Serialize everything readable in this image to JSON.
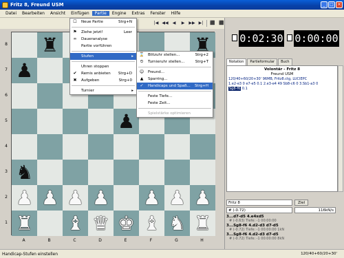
{
  "window": {
    "title": "Fritz 8, Freund USM"
  },
  "menubar": [
    "Datei",
    "Bearbeiten",
    "Ansicht",
    "Einfügen",
    "Partie",
    "Engine",
    "Extras",
    "Fenster",
    "Hilfe"
  ],
  "toolbar": {
    "buttons": [
      "|◀",
      "◀◀",
      "◀",
      "▶",
      "▶▶",
      "▶|",
      "⬛",
      "⬛"
    ]
  },
  "board": {
    "ranks": [
      "8",
      "7",
      "6",
      "5",
      "4",
      "3",
      "2",
      "1"
    ],
    "files": [
      "A",
      "B",
      "C",
      "D",
      "E",
      "F",
      "G",
      "H"
    ],
    "squares": [
      [
        "",
        "♜",
        "",
        "",
        "",
        "",
        "",
        "♜"
      ],
      [
        "♟",
        "",
        "",
        "",
        "",
        "",
        "",
        "♟"
      ],
      [
        "",
        "",
        "",
        "",
        "",
        "",
        "",
        "",
        ""
      ],
      [
        "",
        "",
        "",
        "",
        "♟",
        "",
        "",
        ""
      ],
      [
        "",
        "",
        "",
        "",
        "",
        "",
        "",
        ""
      ],
      [
        "♞",
        "",
        "",
        "",
        "",
        "",
        "",
        ""
      ],
      [
        "♙",
        "♙",
        "♙",
        "♙",
        "",
        "♙",
        "♙",
        "♙"
      ],
      [
        "♖",
        "",
        "♗",
        "♕",
        "♔",
        "♗",
        "♘",
        "♖"
      ]
    ]
  },
  "clocks": {
    "white": "0:02:30",
    "black": "0:00:00"
  },
  "notation": {
    "tabs": [
      "Notation",
      "Partieformular",
      "Buch"
    ],
    "header1": "Volontär - Fritz 8",
    "header2": "Freund USM",
    "info": "120/40+60/20+30' 96MB, Fritz8.ctg, LUCIEPC",
    "moves": "1.e2-e3 0 e7-e5 0.1 2.e3-e4 49 Sb8-c6 0 3.Sb1-a3 0",
    "hl_move": "Sg8-f6",
    "hl_eval": "0.1"
  },
  "engine": {
    "name": "Fritz 8",
    "ziel_label": "Ziel",
    "eval": "# (-0.72)",
    "speed": "116kN/s",
    "lines": [
      {
        "move": "3...d7-d5 4.e4xd5",
        "detail": "# (-0.63)  Tiefe: -1  00:00:00"
      },
      {
        "move": "3...Sg8-f6 4.d2-d3 d7-d5",
        "detail": "# (-0.72)  Tiefe: -1  00:00:00  1kN"
      },
      {
        "move": "3...Sg8-f6 4.d2-d3 d7-d5",
        "detail": "# (-0.72)  Tiefe: -1  00:00:00  8kN"
      }
    ]
  },
  "menu_partie": {
    "items": [
      {
        "label": "Neue Partie",
        "shortcut": "Strg+N",
        "icon": "new-game-icon",
        "glyph": "☐"
      },
      {
        "sep": true
      },
      {
        "label": "Ziehe jetzt!",
        "shortcut": "Leer",
        "icon": "move-now-icon",
        "glyph": "⚑"
      },
      {
        "label": "Daueranalyse",
        "shortcut": "",
        "icon": "analysis-icon",
        "glyph": "∞"
      },
      {
        "label": "Partie vorführen",
        "shortcut": "",
        "icon": "",
        "glyph": ""
      },
      {
        "sep": true
      },
      {
        "label": "Stufen",
        "shortcut": "",
        "icon": "",
        "glyph": "",
        "hl": true,
        "arrow": true
      },
      {
        "sep": true
      },
      {
        "label": "Uhren stoppen",
        "shortcut": "",
        "icon": "",
        "glyph": ""
      },
      {
        "label": "Remis anbieten",
        "shortcut": "Strg+D",
        "icon": "draw-offer-icon",
        "glyph": "✔"
      },
      {
        "label": "Aufgeben",
        "shortcut": "Strg+0",
        "icon": "resign-icon",
        "glyph": "✖"
      },
      {
        "sep": true
      },
      {
        "label": "Turnier",
        "shortcut": "",
        "icon": "",
        "glyph": "",
        "arrow": true
      }
    ]
  },
  "menu_stufen": {
    "items": [
      {
        "label": "Blitzuhr stellen...",
        "shortcut": "Strg+2",
        "icon": "blitz-clock-icon",
        "glyph": "⌛"
      },
      {
        "label": "Turnieruhr stellen...",
        "shortcut": "Strg+T",
        "icon": "tournament-clock-icon",
        "glyph": "⏲"
      },
      {
        "sep": true
      },
      {
        "label": "Freund...",
        "shortcut": "",
        "icon": "friend-icon",
        "glyph": "☺"
      },
      {
        "label": "Sparring...",
        "shortcut": "",
        "icon": "sparring-icon",
        "glyph": "▲"
      },
      {
        "label": "Handicaps und Spaß...",
        "shortcut": "Strg+H",
        "icon": "handicap-icon",
        "glyph": "✓",
        "hl": true
      },
      {
        "sep": true
      },
      {
        "label": "Feste Tiefe...",
        "shortcut": "",
        "icon": "",
        "glyph": ""
      },
      {
        "label": "Feste Zeit...",
        "shortcut": "",
        "icon": "",
        "glyph": ""
      },
      {
        "sep": true
      },
      {
        "label": "Spielstärke optimieren",
        "shortcut": "",
        "icon": "",
        "glyph": "",
        "dis": true
      }
    ]
  },
  "statusbar": {
    "text": "Handicap-Stufen einstellen",
    "right": "120/40+60/20+30'"
  }
}
